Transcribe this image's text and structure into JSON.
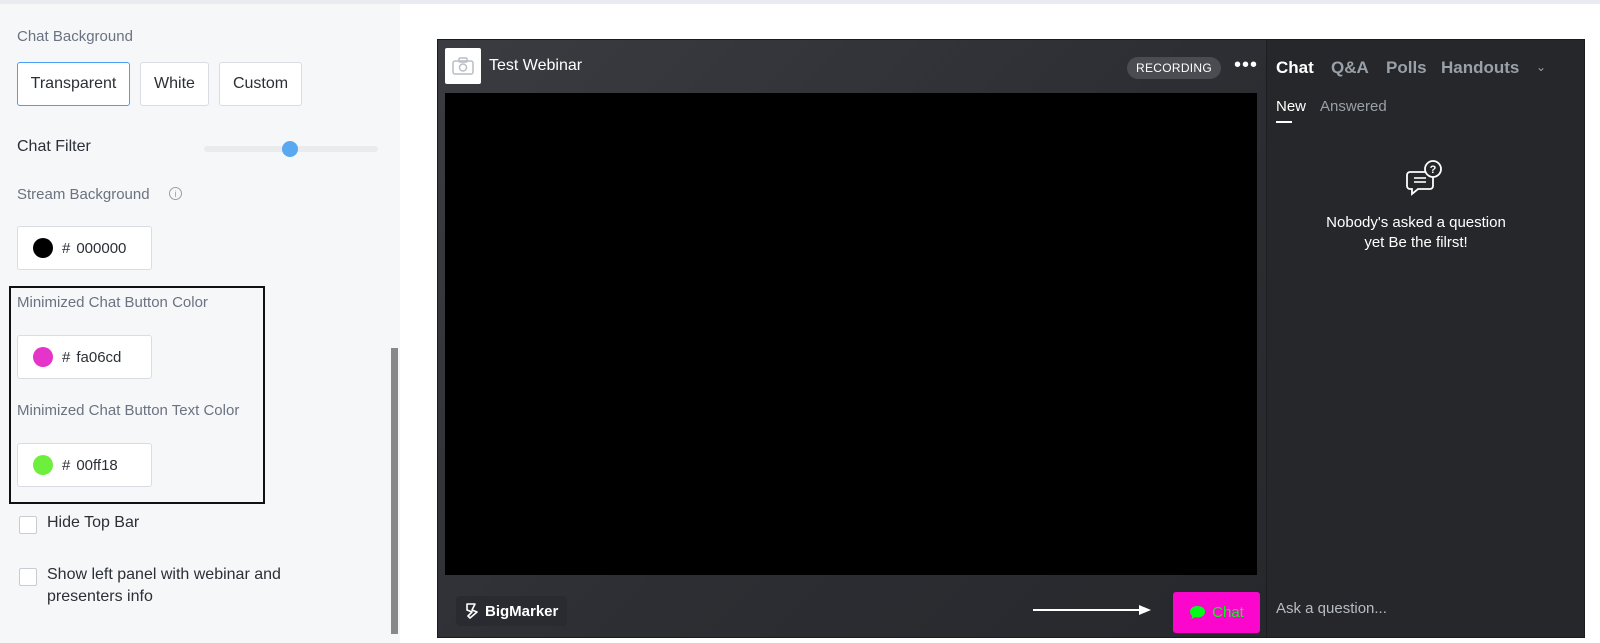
{
  "settings": {
    "chat_background": {
      "label": "Chat Background",
      "options": [
        "Transparent",
        "White",
        "Custom"
      ],
      "selected": "Transparent"
    },
    "chat_filter": {
      "label": "Chat Filter",
      "level": 0.5
    },
    "stream_background": {
      "label": "Stream Background",
      "info_icon": "info-icon",
      "hash": "#",
      "value": "000000",
      "color": "#000000"
    },
    "min_chat_btn_color": {
      "label": "Minimized Chat Button Color",
      "hash": "#",
      "value": "fa06cd",
      "color": "#fa06cd"
    },
    "min_chat_btn_text_color": {
      "label": "Minimized Chat Button Text Color",
      "hash": "#",
      "value": "00ff18",
      "color": "#00ff18"
    },
    "hide_top_bar": {
      "label": "Hide Top Bar",
      "checked": false
    },
    "show_left_panel": {
      "label_line1": "Show left panel with webinar and",
      "label_line2": "presenters info",
      "checked": false
    }
  },
  "preview": {
    "title": "Test Webinar",
    "recording_badge": "RECORDING",
    "more_icon": "more-horizontal-icon",
    "brand": "BigMarker",
    "chat_button": {
      "label": "Chat",
      "icon": "chat-bubble-icon",
      "bg": "#fa06cd",
      "text_color": "#00ff18"
    },
    "sidebar": {
      "tabs": [
        "Chat",
        "Q&A",
        "Polls",
        "Handouts"
      ],
      "active_tab": "Chat",
      "subtabs": [
        "New",
        "Answered"
      ],
      "active_subtab": "New",
      "empty_line1": "Nobody's asked a question",
      "empty_line2": "yet Be the filrst!",
      "ask_placeholder": "Ask a question..."
    }
  }
}
